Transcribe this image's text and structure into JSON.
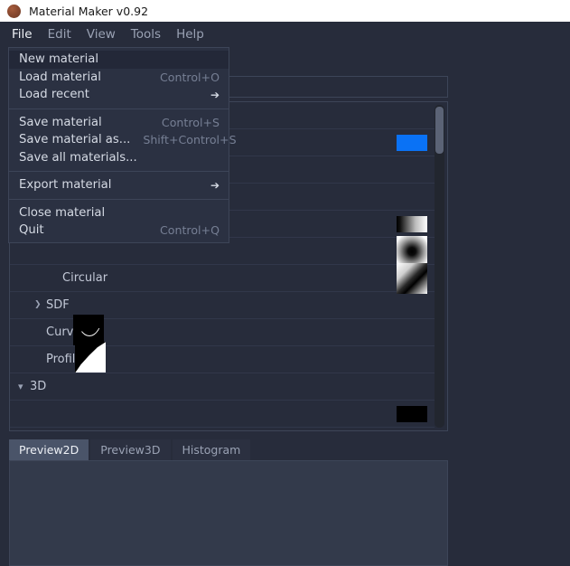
{
  "window": {
    "title": "Material Maker v0.92",
    "app_icon": "sphere-icon",
    "bg_color": "#272c3b",
    "titlebar_color": "#ffffff"
  },
  "menubar": {
    "items": [
      {
        "label": "File",
        "active": true
      },
      {
        "label": "Edit",
        "active": false
      },
      {
        "label": "View",
        "active": false
      },
      {
        "label": "Tools",
        "active": false
      },
      {
        "label": "Help",
        "active": false
      }
    ]
  },
  "file_menu": {
    "open": true,
    "groups": [
      {
        "items": [
          {
            "label": "New material",
            "accel": "",
            "arrow": false,
            "highlight": true
          },
          {
            "label": "Load material",
            "accel": "Control+O",
            "arrow": false,
            "highlight": false
          },
          {
            "label": "Load recent",
            "accel": "",
            "arrow": true,
            "highlight": false
          }
        ]
      },
      {
        "items": [
          {
            "label": "Save material",
            "accel": "Control+S",
            "arrow": false,
            "highlight": false
          },
          {
            "label": "Save material as...",
            "accel": "Shift+Control+S",
            "arrow": false,
            "highlight": false
          },
          {
            "label": "Save all materials...",
            "accel": "",
            "arrow": false,
            "highlight": false
          }
        ]
      },
      {
        "items": [
          {
            "label": "Export material",
            "accel": "",
            "arrow": true,
            "highlight": false
          }
        ]
      },
      {
        "items": [
          {
            "label": "Close material",
            "accel": "",
            "arrow": false,
            "highlight": false
          },
          {
            "label": "Quit",
            "accel": "Control+Q",
            "arrow": false,
            "highlight": false
          }
        ]
      }
    ]
  },
  "library": {
    "search_value": "",
    "search_placeholder": "",
    "rows": [
      {
        "label": "",
        "indent": 0,
        "chevron": "",
        "thumb": "none",
        "tall": false
      },
      {
        "label": "",
        "indent": 0,
        "chevron": "",
        "thumb": "blue",
        "tall": false
      },
      {
        "label": "",
        "indent": 0,
        "chevron": "",
        "thumb": "hex",
        "tall": true
      },
      {
        "label": "",
        "indent": 0,
        "chevron": "",
        "thumb": "sphere",
        "tall": true
      },
      {
        "label": "",
        "indent": 0,
        "chevron": "",
        "thumb": "grad-h",
        "tall": false
      },
      {
        "label": "",
        "indent": 0,
        "chevron": "",
        "thumb": "radial",
        "tall": true
      },
      {
        "label": "Circular",
        "indent": 2,
        "chevron": "",
        "thumb": "corner",
        "tall": true
      },
      {
        "label": "SDF",
        "indent": 1,
        "chevron": "right",
        "thumb": "none",
        "tall": false
      },
      {
        "label": "Curve",
        "indent": 1,
        "chevron": "",
        "thumb": "curve",
        "tall": true
      },
      {
        "label": "Profile",
        "indent": 1,
        "chevron": "",
        "thumb": "profile",
        "tall": true
      },
      {
        "label": "3D",
        "indent": 0,
        "chevron": "down",
        "thumb": "none",
        "tall": false
      },
      {
        "label": "",
        "indent": 0,
        "chevron": "",
        "thumb": "partial",
        "tall": false
      }
    ],
    "scrollbar": {
      "visible": true,
      "thumb_position": "top"
    }
  },
  "preview": {
    "tabs": [
      {
        "label": "Preview2D",
        "active": true
      },
      {
        "label": "Preview3D",
        "active": false
      },
      {
        "label": "Histogram",
        "active": false
      }
    ]
  }
}
